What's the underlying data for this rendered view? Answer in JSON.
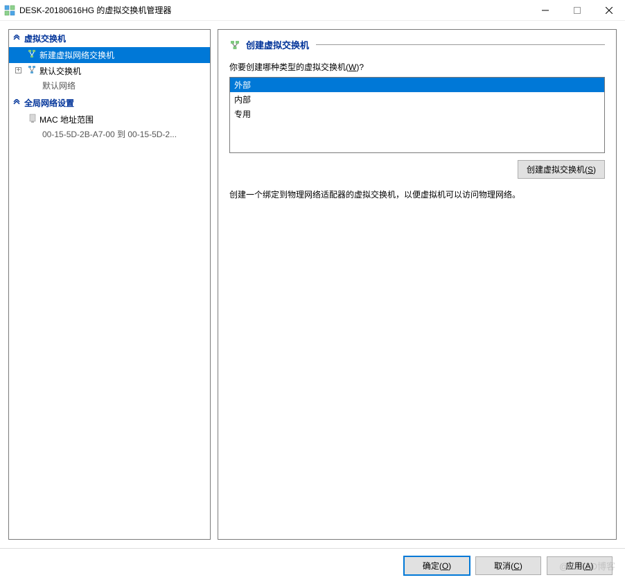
{
  "window": {
    "title": "DESK-20180616HG 的虚拟交换机管理器"
  },
  "sidebar": {
    "section1": {
      "title": "虚拟交换机",
      "items": [
        {
          "label": "新建虚拟网络交换机"
        },
        {
          "label": "默认交换机",
          "sub": "默认网络"
        }
      ]
    },
    "section2": {
      "title": "全局网络设置",
      "items": [
        {
          "label": "MAC 地址范围",
          "sub": "00-15-5D-2B-A7-00 到 00-15-5D-2..."
        }
      ]
    }
  },
  "main": {
    "header": "创建虚拟交换机",
    "prompt_prefix": "你要创建哪种类型的虚拟交换机(",
    "prompt_underline": "W",
    "prompt_suffix": ")?",
    "options": [
      "外部",
      "内部",
      "专用"
    ],
    "create_button_prefix": "创建虚拟交换机(",
    "create_button_underline": "S",
    "create_button_suffix": ")",
    "description": "创建一个绑定到物理网络适配器的虚拟交换机，以便虚拟机可以访问物理网络。"
  },
  "footer": {
    "ok_prefix": "确定(",
    "ok_underline": "O",
    "ok_suffix": ")",
    "cancel_prefix": "取消(",
    "cancel_underline": "C",
    "cancel_suffix": ")",
    "apply_prefix": "应用(",
    "apply_underline": "A",
    "apply_suffix": ")"
  },
  "watermark": "@51CTO博客"
}
